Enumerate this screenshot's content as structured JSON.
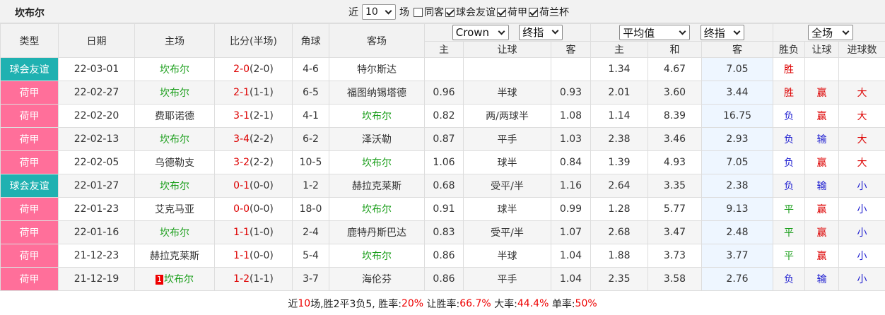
{
  "header": {
    "team": "坎布尔",
    "near_label": "近",
    "count": "10",
    "matches_label": "场",
    "options": [
      {
        "label": "同客",
        "checked": false
      },
      {
        "label": "球会友谊",
        "checked": true
      },
      {
        "label": "荷甲",
        "checked": true
      },
      {
        "label": "荷兰杯",
        "checked": true
      }
    ]
  },
  "columns": {
    "type": "类型",
    "date": "日期",
    "home": "主场",
    "score": "比分(半场)",
    "corner": "角球",
    "away": "客场",
    "company": "Crown",
    "asian_mode": "终指",
    "euro_mode": "平均值",
    "euro_mode2": "终指",
    "scope": "全场",
    "sub_home": "主",
    "sub_handicap": "让球",
    "sub_away": "客",
    "sub_e_home": "主",
    "sub_e_draw": "和",
    "sub_e_away": "客",
    "sub_result": "胜负",
    "sub_hcp_result": "让球",
    "sub_goals": "进球数"
  },
  "matches": [
    {
      "type": "球会友谊",
      "kind": "friendly",
      "date": "22-03-01",
      "home": "坎布尔",
      "home_hl": true,
      "home_card": "",
      "score": "2-0",
      "half": "(2-0)",
      "corner": "4-6",
      "away": "特尔斯达",
      "away_hl": false,
      "a_home": "",
      "a_hcp": "",
      "a_away": "",
      "e_home": "1.34",
      "e_draw": "4.67",
      "e_away": "7.05",
      "result": "胜",
      "result_cls": "win",
      "hcp_result": "",
      "hcp_cls": "",
      "goals": "",
      "goals_cls": ""
    },
    {
      "type": "荷甲",
      "kind": "league",
      "date": "22-02-27",
      "home": "坎布尔",
      "home_hl": true,
      "home_card": "",
      "score": "2-1",
      "half": "(1-1)",
      "corner": "6-5",
      "away": "福图纳锡塔德",
      "away_hl": false,
      "a_home": "0.96",
      "a_hcp": "半球",
      "a_away": "0.93",
      "e_home": "2.01",
      "e_draw": "3.60",
      "e_away": "3.44",
      "result": "胜",
      "result_cls": "win",
      "hcp_result": "赢",
      "hcp_cls": "win",
      "goals": "大",
      "goals_cls": "big"
    },
    {
      "type": "荷甲",
      "kind": "league",
      "date": "22-02-20",
      "home": "费耶诺德",
      "home_hl": false,
      "home_card": "",
      "score": "3-1",
      "half": "(2-1)",
      "corner": "4-1",
      "away": "坎布尔",
      "away_hl": true,
      "a_home": "0.82",
      "a_hcp": "两/两球半",
      "a_away": "1.08",
      "e_home": "1.14",
      "e_draw": "8.39",
      "e_away": "16.75",
      "result": "负",
      "result_cls": "lose",
      "hcp_result": "赢",
      "hcp_cls": "win",
      "goals": "大",
      "goals_cls": "big"
    },
    {
      "type": "荷甲",
      "kind": "league",
      "date": "22-02-13",
      "home": "坎布尔",
      "home_hl": true,
      "home_card": "",
      "score": "3-4",
      "half": "(2-2)",
      "corner": "6-2",
      "away": "泽沃勒",
      "away_hl": false,
      "a_home": "0.87",
      "a_hcp": "平手",
      "a_away": "1.03",
      "e_home": "2.38",
      "e_draw": "3.46",
      "e_away": "2.93",
      "result": "负",
      "result_cls": "lose",
      "hcp_result": "输",
      "hcp_cls": "lose",
      "goals": "大",
      "goals_cls": "big"
    },
    {
      "type": "荷甲",
      "kind": "league",
      "date": "22-02-05",
      "home": "乌德勒支",
      "home_hl": false,
      "home_card": "",
      "score": "3-2",
      "half": "(2-2)",
      "corner": "10-5",
      "away": "坎布尔",
      "away_hl": true,
      "a_home": "1.06",
      "a_hcp": "球半",
      "a_away": "0.84",
      "e_home": "1.39",
      "e_draw": "4.93",
      "e_away": "7.05",
      "result": "负",
      "result_cls": "lose",
      "hcp_result": "赢",
      "hcp_cls": "win",
      "goals": "大",
      "goals_cls": "big"
    },
    {
      "type": "球会友谊",
      "kind": "friendly",
      "date": "22-01-27",
      "home": "坎布尔",
      "home_hl": true,
      "home_card": "",
      "score": "0-1",
      "half": "(0-0)",
      "corner": "1-2",
      "away": "赫拉克莱斯",
      "away_hl": false,
      "a_home": "0.68",
      "a_hcp": "受平/半",
      "a_away": "1.16",
      "e_home": "2.64",
      "e_draw": "3.35",
      "e_away": "2.38",
      "result": "负",
      "result_cls": "lose",
      "hcp_result": "输",
      "hcp_cls": "lose",
      "goals": "小",
      "goals_cls": "small"
    },
    {
      "type": "荷甲",
      "kind": "league",
      "date": "22-01-23",
      "home": "艾克马亚",
      "home_hl": false,
      "home_card": "",
      "score": "0-0",
      "half": "(0-0)",
      "corner": "18-0",
      "away": "坎布尔",
      "away_hl": true,
      "a_home": "0.91",
      "a_hcp": "球半",
      "a_away": "0.99",
      "e_home": "1.28",
      "e_draw": "5.77",
      "e_away": "9.13",
      "result": "平",
      "result_cls": "draw",
      "hcp_result": "赢",
      "hcp_cls": "win",
      "goals": "小",
      "goals_cls": "small"
    },
    {
      "type": "荷甲",
      "kind": "league",
      "date": "22-01-16",
      "home": "坎布尔",
      "home_hl": true,
      "home_card": "",
      "score": "1-1",
      "half": "(1-0)",
      "corner": "2-4",
      "away": "鹿特丹斯巴达",
      "away_hl": false,
      "a_home": "0.83",
      "a_hcp": "受平/半",
      "a_away": "1.07",
      "e_home": "2.68",
      "e_draw": "3.47",
      "e_away": "2.48",
      "result": "平",
      "result_cls": "draw",
      "hcp_result": "赢",
      "hcp_cls": "win",
      "goals": "小",
      "goals_cls": "small"
    },
    {
      "type": "荷甲",
      "kind": "league",
      "date": "21-12-23",
      "home": "赫拉克莱斯",
      "home_hl": false,
      "home_card": "",
      "score": "1-1",
      "half": "(0-0)",
      "corner": "5-4",
      "away": "坎布尔",
      "away_hl": true,
      "a_home": "0.86",
      "a_hcp": "半球",
      "a_away": "1.04",
      "e_home": "1.88",
      "e_draw": "3.73",
      "e_away": "3.77",
      "result": "平",
      "result_cls": "draw",
      "hcp_result": "赢",
      "hcp_cls": "win",
      "goals": "小",
      "goals_cls": "small"
    },
    {
      "type": "荷甲",
      "kind": "league",
      "date": "21-12-19",
      "home": "坎布尔",
      "home_hl": true,
      "home_card": "1",
      "score": "1-2",
      "half": "(1-1)",
      "corner": "3-7",
      "away": "海伦芬",
      "away_hl": false,
      "a_home": "0.86",
      "a_hcp": "平手",
      "a_away": "1.04",
      "e_home": "2.35",
      "e_draw": "3.58",
      "e_away": "2.76",
      "result": "负",
      "result_cls": "lose",
      "hcp_result": "输",
      "hcp_cls": "lose",
      "goals": "小",
      "goals_cls": "small"
    }
  ],
  "summary": {
    "part1": "近",
    "count": "10",
    "part2": "场,胜2平3负5, 胜率:",
    "win_rate": "20%",
    "part3": " 让胜率:",
    "hcp_rate": "66.7%",
    "part4": " 大率:",
    "big_rate": "44.4%",
    "part5": " 单率:",
    "odd_rate": "50%"
  }
}
